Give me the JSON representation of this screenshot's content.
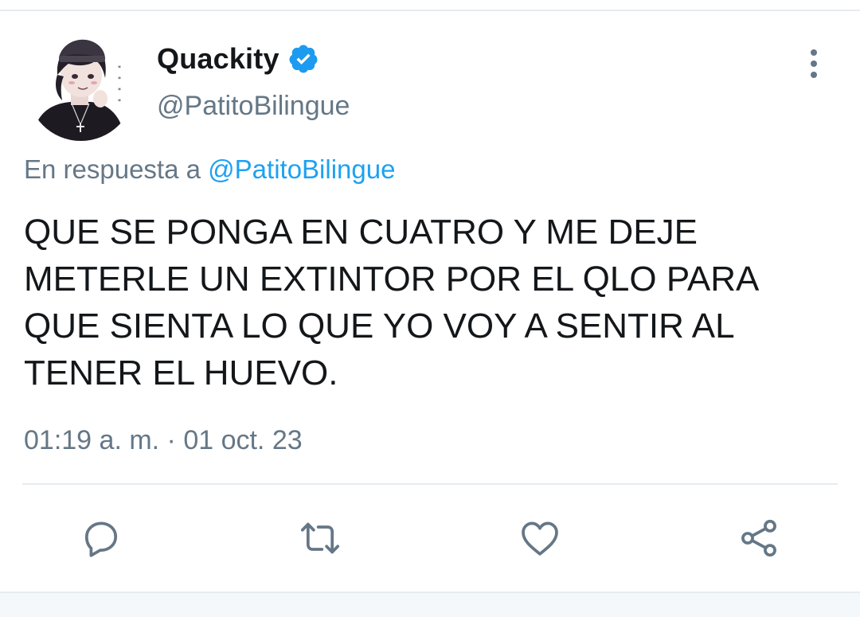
{
  "author": {
    "display_name": "Quackity",
    "handle": "@PatitoBilingue",
    "verified": true,
    "avatar_icon": "illustrated-avatar"
  },
  "reply_context": {
    "prefix": "En respuesta a",
    "mention": "@PatitoBilingue"
  },
  "tweet": {
    "lines": [
      "QUE SE PONGA EN CUATRO Y ME DEJE",
      "METERLE UN EXTINTOR POR EL QLO PARA",
      "QUE SIENTA LO QUE YO VOY A SENTIR AL",
      "TENER EL HUEVO."
    ],
    "timestamp": "01:19 a. m. · 01 oct. 23"
  },
  "actions": [
    {
      "name": "reply",
      "icon": "reply-icon"
    },
    {
      "name": "retweet",
      "icon": "retweet-icon"
    },
    {
      "name": "like",
      "icon": "heart-icon"
    },
    {
      "name": "share",
      "icon": "share-icon"
    }
  ],
  "colors": {
    "accent": "#1da1f2",
    "verified": "#1d9bf0",
    "secondary_text": "#657786",
    "primary_text": "#14171a",
    "icon": "#657786",
    "divider": "#e6ecf0"
  }
}
